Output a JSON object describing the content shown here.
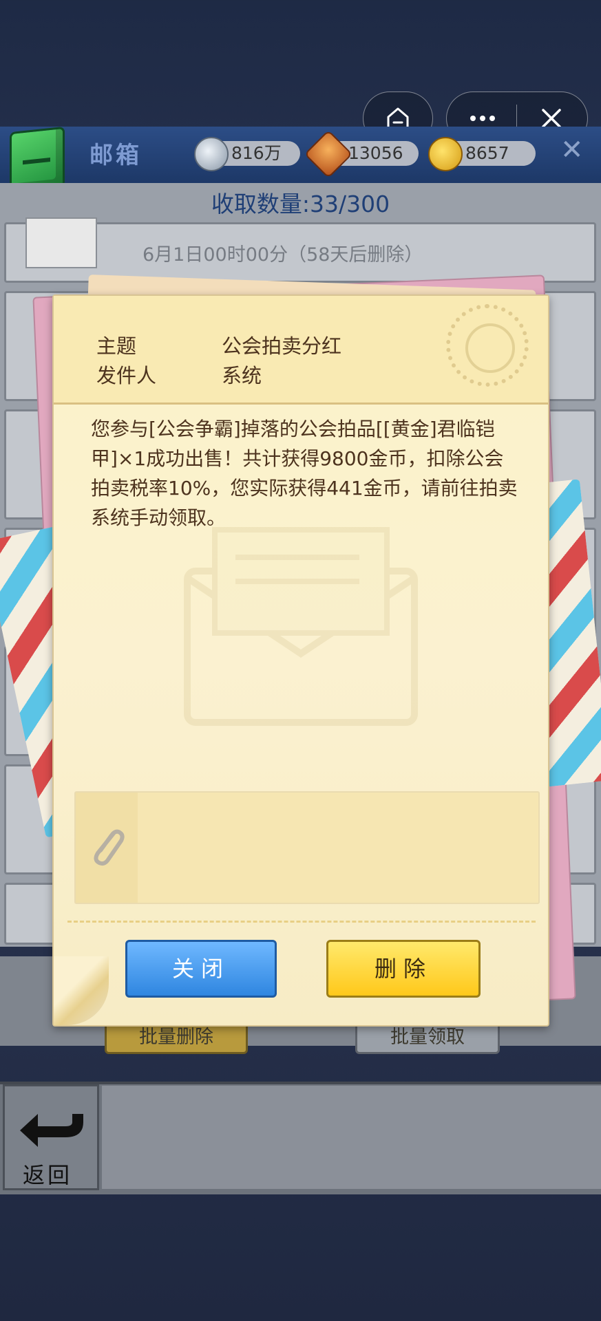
{
  "miniprogram": {
    "home_icon": "home-icon",
    "more_icon": "more-dots-icon",
    "close_icon": "close-icon"
  },
  "header": {
    "title": "邮箱",
    "resources": [
      {
        "name": "silver",
        "value": "816万"
      },
      {
        "name": "gem",
        "value": "13056"
      },
      {
        "name": "gold",
        "value": "8657"
      }
    ],
    "close_symbol": "✕"
  },
  "mailbox": {
    "count_text": "收取数量:33/300",
    "first_row_date": "6月1日00时00分（58天后删除）",
    "batch_delete_label": "批量删除",
    "batch_collect_label": "批量领取"
  },
  "footer": {
    "back_label": "返回"
  },
  "letter": {
    "subject_label": "主题",
    "subject_value": "公会拍卖分红",
    "sender_label": "发件人",
    "sender_value": "系统",
    "body": "您参与[公会争霸]掉落的公会拍品[[黄金]君临铠甲]×1成功出售！共计获得9800金币，扣除公会拍卖税率10%，您实际获得441金币，请前往拍卖系统手动领取。",
    "close_label": "关闭",
    "delete_label": "删除"
  },
  "colors": {
    "close_button": "#3b8ef0",
    "delete_button": "#ffd21e",
    "text_brown": "#4d331e"
  }
}
